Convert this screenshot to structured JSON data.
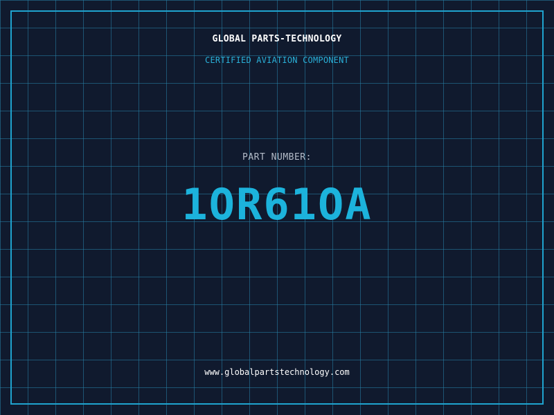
{
  "header": {
    "brand": "GLOBAL PARTS-TECHNOLOGY",
    "subtitle": "CERTIFIED AVIATION COMPONENT"
  },
  "part": {
    "label": "PART NUMBER:",
    "number": "1OR61OA"
  },
  "footer": {
    "website": "www.globalpartstechnology.com"
  },
  "colors": {
    "background": "#101a2e",
    "grid": "#2882aa",
    "accent": "#1cb3dc",
    "frame": "#1fa3cf"
  }
}
